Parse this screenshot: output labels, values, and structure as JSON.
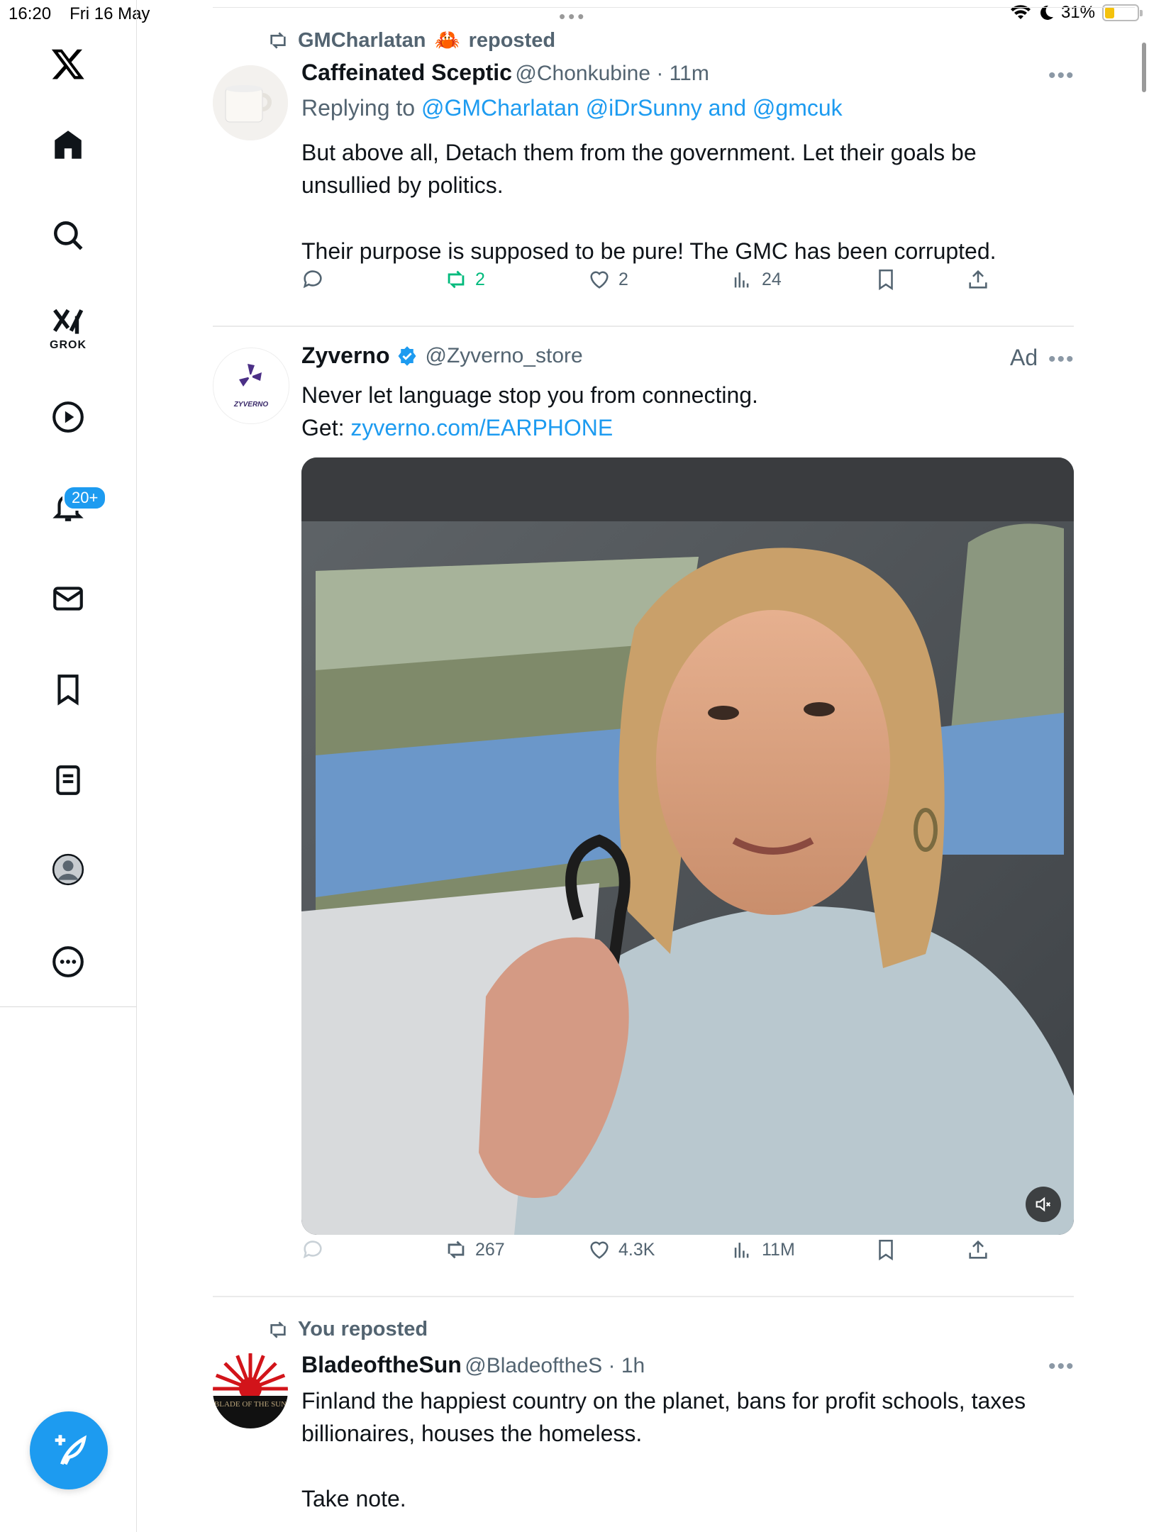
{
  "status_bar": {
    "time": "16:20",
    "date": "Fri 16 May",
    "battery": "31%",
    "battery_level": 0.31
  },
  "sidebar": {
    "logo": "x-logo-icon",
    "items": [
      {
        "icon": "home-icon"
      },
      {
        "icon": "search-icon"
      },
      {
        "icon": "grok-icon",
        "label": "GROK"
      },
      {
        "icon": "video-icon"
      },
      {
        "icon": "bell-icon",
        "badge": "20+"
      },
      {
        "icon": "mail-icon"
      },
      {
        "icon": "bookmark-icon"
      },
      {
        "icon": "lists-icon"
      },
      {
        "icon": "profile-icon"
      },
      {
        "icon": "more-icon"
      }
    ],
    "compose_icon": "compose-icon"
  },
  "posts": [
    {
      "repost_by": "GMCharlatan",
      "repost_emoji": "🦀",
      "repost_suffix": "reposted",
      "name": "Caffeinated Sceptic",
      "handle": "@Chonkubine",
      "time": "11m",
      "replying_label": "Replying to",
      "replying_to": "@GMCharlatan @iDrSunny and @gmcuk",
      "text_1": "But above all, Detach them from the government. Let their goals be unsullied by politics.",
      "text_2": "Their purpose is supposed to be pure! The GMC has been corrupted.",
      "reposts": "2",
      "likes": "2",
      "views": "24",
      "accent_repost": "#00ba7c"
    },
    {
      "name": "Zyverno",
      "verified": true,
      "handle": "@Zyverno_store",
      "ad_label": "Ad",
      "avatar_text": "ZYVERNO",
      "text_1": "Never let language stop you from connecting.",
      "get_label": "Get:",
      "link": "zyverno.com/EARPHONE",
      "reposts": "267",
      "likes": "4.3K",
      "views": "11M"
    },
    {
      "repost_label": "You reposted",
      "name": "BladeoftheSun",
      "handle": "@BladeoftheS",
      "time": "1h",
      "avatar_text": "BLADE OF THE SUN",
      "text_1": "Finland the happiest country on the planet, bans for profit schools, taxes billionaires, houses the homeless.",
      "text_2": "Take note."
    }
  ],
  "colors": {
    "accent": "#1d9bf0",
    "muted": "#536471"
  }
}
